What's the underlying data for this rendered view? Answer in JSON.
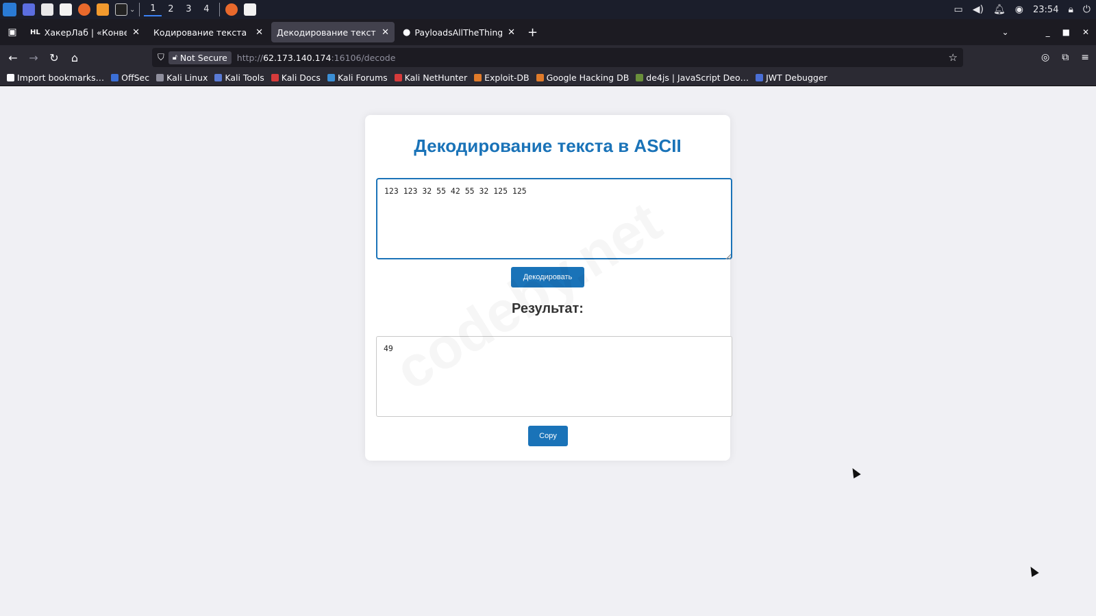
{
  "taskbar": {
    "workspaces": [
      "1",
      "2",
      "3",
      "4"
    ],
    "clock": "23:54"
  },
  "tabs": [
    {
      "favicon": "HL",
      "title": "ХакерЛаб | «Конвертер»"
    },
    {
      "favicon": "",
      "title": "Кодирование текста в ASCII"
    },
    {
      "favicon": "",
      "title": "Декодирование текста из ASCII"
    },
    {
      "favicon": "github",
      "title": "PayloadsAllTheThings/Se"
    }
  ],
  "nav": {
    "security_label": "Not Secure",
    "url_prefix": "http://",
    "url_host": "62.173.140.174",
    "url_rest": ":16106/decode"
  },
  "bookmarks": [
    {
      "label": "Import bookmarks…",
      "color": "#fbfbfe"
    },
    {
      "label": "OffSec",
      "color": "#3b6fd6"
    },
    {
      "label": "Kali Linux",
      "color": "#8f8f9d"
    },
    {
      "label": "Kali Tools",
      "color": "#5a7bd6"
    },
    {
      "label": "Kali Docs",
      "color": "#d63b3b"
    },
    {
      "label": "Kali Forums",
      "color": "#3b8fd6"
    },
    {
      "label": "Kali NetHunter",
      "color": "#d63b3b"
    },
    {
      "label": "Exploit-DB",
      "color": "#e07b2a"
    },
    {
      "label": "Google Hacking DB",
      "color": "#e07b2a"
    },
    {
      "label": "de4js | JavaScript Deo…",
      "color": "#6a8f3b"
    },
    {
      "label": "JWT Debugger",
      "color": "#4a6fd6"
    }
  ],
  "page": {
    "title": "Декодирование текста в ASCII",
    "input_value": "123 123 32 55 42 55 32 125 125",
    "decode_button": "Декодировать",
    "result_label": "Результат:",
    "output_value": "49",
    "copy_button": "Copy",
    "watermark": "codeby.net"
  }
}
